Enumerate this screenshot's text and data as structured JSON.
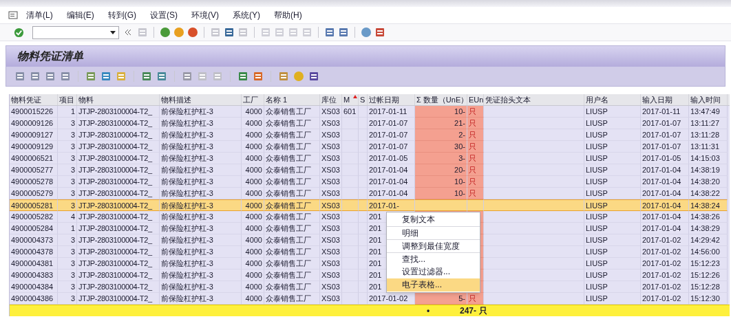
{
  "menu_bar": {
    "items": [
      "清单(L)",
      "编辑(E)",
      "转到(G)",
      "设置(S)",
      "环境(V)",
      "系统(Y)",
      "帮助(H)"
    ]
  },
  "title": "物料凭证清单",
  "table": {
    "columns": [
      {
        "label": "物料凭证",
        "sorted": false
      },
      {
        "label": "项目",
        "sorted": false
      },
      {
        "label": "物料",
        "sorted": false
      },
      {
        "label": "物料描述",
        "sorted": false
      },
      {
        "label": "工厂",
        "sorted": false
      },
      {
        "label": "名称 1",
        "sorted": false
      },
      {
        "label": "库位",
        "sorted": false
      },
      {
        "label": "M",
        "sorted": true
      },
      {
        "label": "S",
        "sorted": false
      },
      {
        "label": "过帐日期",
        "sorted": false
      },
      {
        "label": "Σ 数量（UnE）",
        "sorted": false
      },
      {
        "label": "EUn",
        "sorted": false
      },
      {
        "label": "凭证抬头文本",
        "sorted": false
      },
      {
        "label": "用户名",
        "sorted": false
      },
      {
        "label": "输入日期",
        "sorted": false
      },
      {
        "label": "输入时间",
        "sorted": false
      }
    ],
    "rows": [
      {
        "selected": false,
        "cells": [
          "4900015226",
          "1",
          "JTJP-2803100004-T2_",
          "前保险杠护杠-3",
          "4000",
          "众泰销售工厂",
          "XS03",
          "601",
          null,
          "2017-01-11",
          "10-",
          "只",
          null,
          "LIUSP",
          "2017-01-11",
          "13:47:49"
        ]
      },
      {
        "selected": false,
        "cells": [
          "4900009126",
          "3",
          "JTJP-2803100004-T2_",
          "前保险杠护杠-3",
          "4000",
          "众泰销售工厂",
          "XS03",
          null,
          null,
          "2017-01-07",
          "21-",
          "只",
          null,
          "LIUSP",
          "2017-01-07",
          "13:11:27"
        ]
      },
      {
        "selected": false,
        "cells": [
          "4900009127",
          "3",
          "JTJP-2803100004-T2_",
          "前保险杠护杠-3",
          "4000",
          "众泰销售工厂",
          "XS03",
          null,
          null,
          "2017-01-07",
          "2-",
          "只",
          null,
          "LIUSP",
          "2017-01-07",
          "13:11:28"
        ]
      },
      {
        "selected": false,
        "cells": [
          "4900009129",
          "3",
          "JTJP-2803100004-T2_",
          "前保险杠护杠-3",
          "4000",
          "众泰销售工厂",
          "XS03",
          null,
          null,
          "2017-01-07",
          "30-",
          "只",
          null,
          "LIUSP",
          "2017-01-07",
          "13:11:31"
        ]
      },
      {
        "selected": false,
        "cells": [
          "4900006521",
          "3",
          "JTJP-2803100004-T2_",
          "前保险杠护杠-3",
          "4000",
          "众泰销售工厂",
          "XS03",
          null,
          null,
          "2017-01-05",
          "3-",
          "只",
          null,
          "LIUSP",
          "2017-01-05",
          "14:15:03"
        ]
      },
      {
        "selected": false,
        "cells": [
          "4900005277",
          "3",
          "JTJP-2803100004-T2_",
          "前保险杠护杠-3",
          "4000",
          "众泰销售工厂",
          "XS03",
          null,
          null,
          "2017-01-04",
          "20-",
          "只",
          null,
          "LIUSP",
          "2017-01-04",
          "14:38:19"
        ]
      },
      {
        "selected": false,
        "cells": [
          "4900005278",
          "3",
          "JTJP-2803100004-T2_",
          "前保险杠护杠-3",
          "4000",
          "众泰销售工厂",
          "XS03",
          null,
          null,
          "2017-01-04",
          "10-",
          "只",
          null,
          "LIUSP",
          "2017-01-04",
          "14:38:20"
        ]
      },
      {
        "selected": false,
        "cells": [
          "4900005279",
          "3",
          "JTJP-2803100004-T2_",
          "前保险杠护杠-3",
          "4000",
          "众泰销售工厂",
          "XS03",
          null,
          null,
          "2017-01-04",
          "10-",
          "只",
          null,
          "LIUSP",
          "2017-01-04",
          "14:38:22"
        ]
      },
      {
        "selected": true,
        "cells": [
          "4900005281",
          "3",
          "JTJP-2803100004-T2_",
          "前保险杠护杠-3",
          "4000",
          "众泰销售工厂",
          "XS03",
          null,
          null,
          "2017-01-",
          null,
          null,
          null,
          "LIUSP",
          "2017-01-04",
          "14:38:24"
        ]
      },
      {
        "selected": false,
        "cells": [
          "4900005282",
          "4",
          "JTJP-2803100004-T2_",
          "前保险杠护杠-3",
          "4000",
          "众泰销售工厂",
          "XS03",
          null,
          null,
          "201",
          null,
          null,
          null,
          "LIUSP",
          "2017-01-04",
          "14:38:26"
        ]
      },
      {
        "selected": false,
        "cells": [
          "4900005284",
          "1",
          "JTJP-2803100004-T2_",
          "前保险杠护杠-3",
          "4000",
          "众泰销售工厂",
          "XS03",
          null,
          null,
          "201",
          null,
          null,
          null,
          "LIUSP",
          "2017-01-04",
          "14:38:29"
        ]
      },
      {
        "selected": false,
        "cells": [
          "4900004373",
          "3",
          "JTJP-2803100004-T2_",
          "前保险杠护杠-3",
          "4000",
          "众泰销售工厂",
          "XS03",
          null,
          null,
          "201",
          null,
          null,
          null,
          "LIUSP",
          "2017-01-02",
          "14:29:42"
        ]
      },
      {
        "selected": false,
        "cells": [
          "4900004378",
          "3",
          "JTJP-2803100004-T2_",
          "前保险杠护杠-3",
          "4000",
          "众泰销售工厂",
          "XS03",
          null,
          null,
          "201",
          null,
          null,
          null,
          "LIUSP",
          "2017-01-02",
          "14:56:00"
        ]
      },
      {
        "selected": false,
        "cells": [
          "4900004381",
          "3",
          "JTJP-2803100004-T2_",
          "前保险杠护杠-3",
          "4000",
          "众泰销售工厂",
          "XS03",
          null,
          null,
          "201",
          null,
          null,
          null,
          "LIUSP",
          "2017-01-02",
          "15:12:23"
        ]
      },
      {
        "selected": false,
        "cells": [
          "4900004383",
          "3",
          "JTJP-2803100004-T2_",
          "前保险杠护杠-3",
          "4000",
          "众泰销售工厂",
          "XS03",
          null,
          null,
          "201",
          null,
          null,
          null,
          "LIUSP",
          "2017-01-02",
          "15:12:26"
        ]
      },
      {
        "selected": false,
        "cells": [
          "4900004384",
          "3",
          "JTJP-2803100004-T2_",
          "前保险杠护杠-3",
          "4000",
          "众泰销售工厂",
          "XS03",
          null,
          null,
          "201",
          null,
          null,
          null,
          "LIUSP",
          "2017-01-02",
          "15:12:28"
        ]
      },
      {
        "selected": false,
        "cells": [
          "4900004386",
          "3",
          "JTJP-2803100004-T2_",
          "前保险杠护杠-3",
          "4000",
          "众泰销售工厂",
          "XS03",
          null,
          null,
          "2017-01-02",
          "5-",
          "只",
          null,
          "LIUSP",
          "2017-01-02",
          "15:12:30"
        ]
      }
    ],
    "total": {
      "marker": "•",
      "quantity": "247-",
      "unit": "只"
    }
  },
  "context_menu": {
    "items": [
      {
        "label": "复制文本",
        "selected": false
      },
      {
        "label": "明细",
        "selected": false
      },
      {
        "label": "调整到最佳宽度",
        "selected": false
      },
      {
        "label": "查找...",
        "selected": false
      },
      {
        "label": "设置过滤器...",
        "selected": false
      },
      {
        "label": "电子表格...",
        "selected": true
      }
    ]
  }
}
